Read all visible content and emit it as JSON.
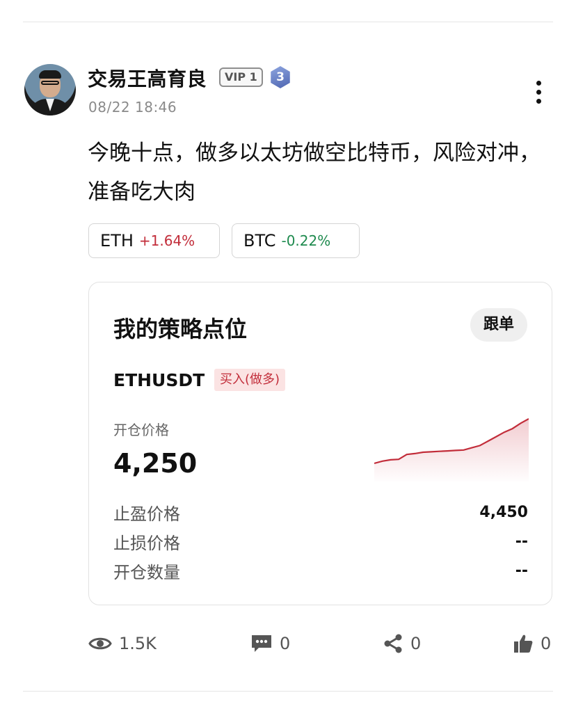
{
  "post": {
    "username": "交易王高育良",
    "vip": "VIP 1",
    "level": "3",
    "timestamp": "08/22 18:46",
    "content": "今晚十点，做多以太坊做空比特币，风险对冲，准备吃大肉"
  },
  "tags": [
    {
      "symbol": "ETH",
      "change": "+1.64%",
      "color": "#c22d3a"
    },
    {
      "symbol": "BTC",
      "change": "-0.22%",
      "color": "#1e8a4e"
    }
  ],
  "strategy_card": {
    "title": "我的策略点位",
    "follow_label": "跟单",
    "pair": "ETHUSDT",
    "side": "买入(做多)",
    "open_price_label": "开仓价格",
    "open_price": "4,250",
    "rows": [
      {
        "label": "止盈价格",
        "value": "4,450"
      },
      {
        "label": "止损价格",
        "value": "--"
      },
      {
        "label": "开仓数量",
        "value": "--"
      }
    ],
    "sparkline": [
      0,
      0.05,
      0.08,
      0.09,
      0.2,
      0.22,
      0.25,
      0.26,
      0.27,
      0.28,
      0.29,
      0.3,
      0.35,
      0.4,
      0.5,
      0.6,
      0.7,
      0.78,
      0.9,
      1.0
    ],
    "sparkline_color": "#c22d3a"
  },
  "footer": {
    "views": "1.5K",
    "comments": "0",
    "shares": "0",
    "likes": "0"
  },
  "icons": {
    "views": "eye-icon",
    "comments": "comment-icon",
    "shares": "share-icon",
    "likes": "thumbs-up-icon",
    "more": "more-vertical-icon"
  }
}
